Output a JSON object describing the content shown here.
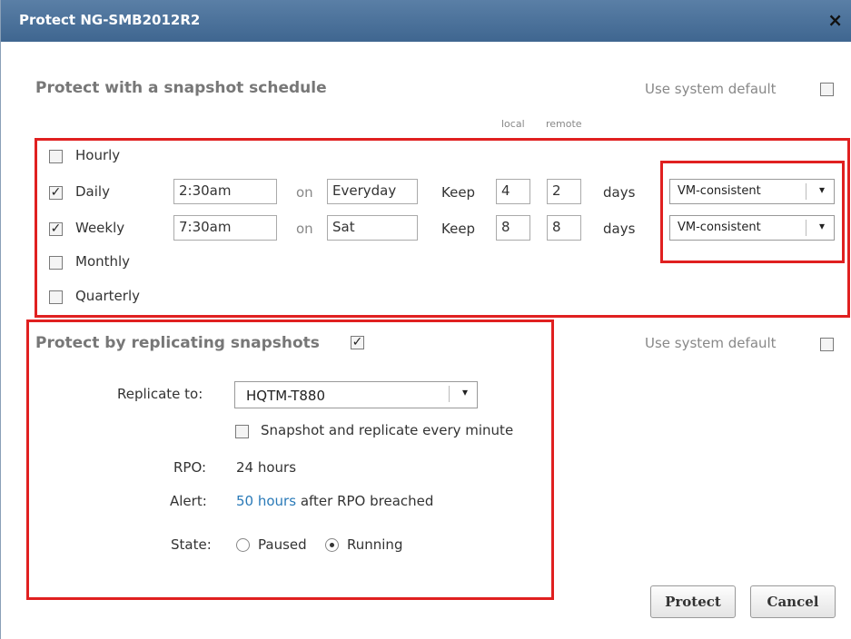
{
  "dialog": {
    "title": "Protect NG-SMB2012R2",
    "close_glyph": "×"
  },
  "snapshot": {
    "heading": "Protect with a snapshot schedule",
    "use_default_label": "Use system default",
    "use_default_checked": false,
    "col_local": "local",
    "col_remote": "remote",
    "rows": [
      {
        "label": "Hourly",
        "checked": false
      },
      {
        "label": "Daily",
        "checked": true,
        "time": "2:30am",
        "on": "on",
        "day": "Everyday",
        "keep": "Keep",
        "local": "4",
        "remote": "2",
        "days": "days",
        "consistency": "VM-consistent"
      },
      {
        "label": "Weekly",
        "checked": true,
        "time": "7:30am",
        "on": "on",
        "day": "Sat",
        "keep": "Keep",
        "local": "8",
        "remote": "8",
        "days": "days",
        "consistency": "VM-consistent"
      },
      {
        "label": "Monthly",
        "checked": false
      },
      {
        "label": "Quarterly",
        "checked": false
      }
    ]
  },
  "replication": {
    "heading": "Protect by replicating snapshots",
    "heading_checked": true,
    "use_default_label": "Use system default",
    "use_default_checked": false,
    "replicate_to_label": "Replicate to:",
    "replicate_to_value": "HQTM-T880",
    "every_minute_label": "Snapshot and replicate every minute",
    "every_minute_checked": false,
    "rpo_label": "RPO:",
    "rpo_value": "24 hours",
    "alert_label": "Alert:",
    "alert_link": "50 hours",
    "alert_suffix": "after RPO breached",
    "state_label": "State:",
    "state_paused": "Paused",
    "state_running": "Running",
    "state_selected": "Running"
  },
  "buttons": {
    "protect": "Protect",
    "cancel": "Cancel"
  },
  "icons": {
    "check": "✓",
    "dropdown": "▾"
  },
  "colors": {
    "title_bar": "#4a719b",
    "highlight_box": "#e02020",
    "link": "#2a7ab8"
  }
}
